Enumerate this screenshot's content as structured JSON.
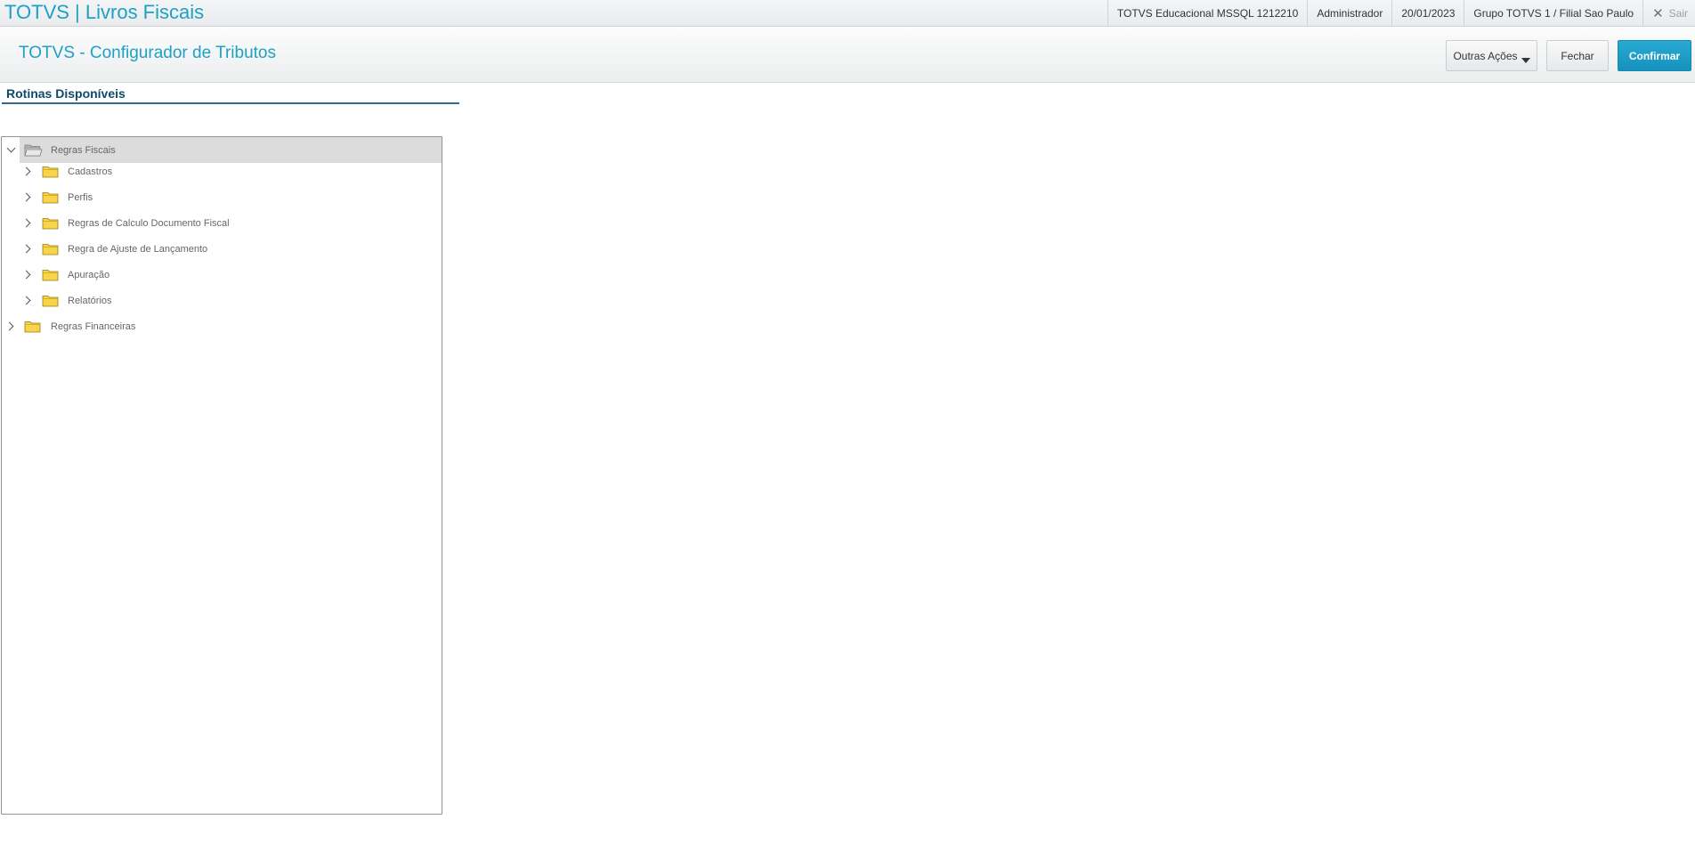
{
  "app": {
    "title": "TOTVS | Livros Fiscais"
  },
  "status": {
    "environment": "TOTVS Educacional MSSQL 1212210",
    "user": "Administrador",
    "date": "20/01/2023",
    "company": "Grupo TOTVS 1 / Filial Sao Paulo",
    "logout_label": "Sair"
  },
  "header": {
    "title": "TOTVS - Configurador de Tributos",
    "other_actions_label": "Outras Ações",
    "close_label": "Fechar",
    "confirm_label": "Confirmar"
  },
  "section": {
    "title": "Rotinas Disponíveis"
  },
  "tree": {
    "root_fiscal": {
      "label": "Regras Fiscais",
      "expanded": true,
      "selected": true
    },
    "children": [
      {
        "label": "Cadastros",
        "expanded": false
      },
      {
        "label": "Perfis",
        "expanded": false
      },
      {
        "label": "Regras de Calculo Documento Fiscal",
        "expanded": false
      },
      {
        "label": "Regra de Ajuste de Lançamento",
        "expanded": false
      },
      {
        "label": "Apuração",
        "expanded": false
      },
      {
        "label": "Relatórios",
        "expanded": false
      }
    ],
    "root_financial": {
      "label": "Regras Financeiras",
      "expanded": false
    }
  },
  "colors": {
    "accent": "#1fa0c5",
    "confirm_button": "#1592bd",
    "section_title": "#0e4a6a",
    "folder_fill": "#f7d54a",
    "selected_row": "#dcdcdc"
  }
}
